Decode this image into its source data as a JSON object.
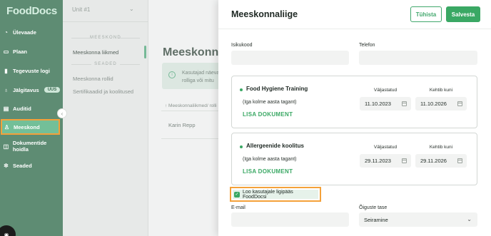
{
  "brand": {
    "logo": "FoodDocs",
    "accent": "#3aa864",
    "sidebar_bg": "#5e8c73",
    "highlight": "#f4a13a"
  },
  "sidebar": {
    "items": [
      {
        "label": "Ülevaade",
        "icon": "chart-icon"
      },
      {
        "label": "Plaan",
        "icon": "book-icon"
      },
      {
        "label": "Tegevuste logi",
        "icon": "bars-icon"
      },
      {
        "label": "Jälgitavus",
        "icon": "apple-icon",
        "badge": "UUS"
      },
      {
        "label": "Auditid",
        "icon": "clipboard-icon"
      },
      {
        "label": "Meeskond",
        "icon": "person-icon",
        "active": true
      },
      {
        "label": "Dokumentide hoidla",
        "icon": "folder-icon"
      },
      {
        "label": "Seaded",
        "icon": "gear-icon"
      }
    ]
  },
  "subnav": {
    "unit": "Unit #1",
    "sections": [
      {
        "title": "MEESKOND",
        "items": [
          "Meeskonna liikmed"
        ]
      },
      {
        "title": "SEADED",
        "items": [
          "Meeskonna rollid",
          "Sertifikaadid ja koolitused"
        ]
      }
    ]
  },
  "main": {
    "title": "Meeskonnaliikmed",
    "info_line1": "Kasutajad näevad",
    "info_line2": "rolliga või mitu",
    "column_header": "↑ Meeskonnaliikmed/ rolli",
    "rows": [
      "Karin Repp"
    ]
  },
  "drawer": {
    "title": "Meeskonnaliige",
    "cancel_label": "Tühista",
    "save_label": "Salvesta",
    "fields": {
      "isikukood_label": "Isikukood",
      "telefon_label": "Telefon",
      "email_label": "E-mail",
      "role_label": "Õiguste tase",
      "role_value": "Seiramine"
    },
    "trainings": [
      {
        "title": "Food Hygiene Training",
        "subtitle": "(Iga kolme aasta tagant)",
        "link": "LISA DOKUMENT",
        "issued_label": "Väljastatud",
        "issued": "11.10.2023",
        "valid_label": "Kehtib kuni",
        "valid": "11.10.2026"
      },
      {
        "title": "Allergeenide koolitus",
        "subtitle": "(Iga kolme aasta tagant)",
        "link": "LISA DOKUMENT",
        "issued_label": "Väljastatud",
        "issued": "29.11.2023",
        "valid_label": "Kehtib kuni",
        "valid": "29.11.2026"
      }
    ],
    "access_checkbox": {
      "label": "Loo kasutajale ligipääs FoodDocsi",
      "checked": true
    }
  }
}
